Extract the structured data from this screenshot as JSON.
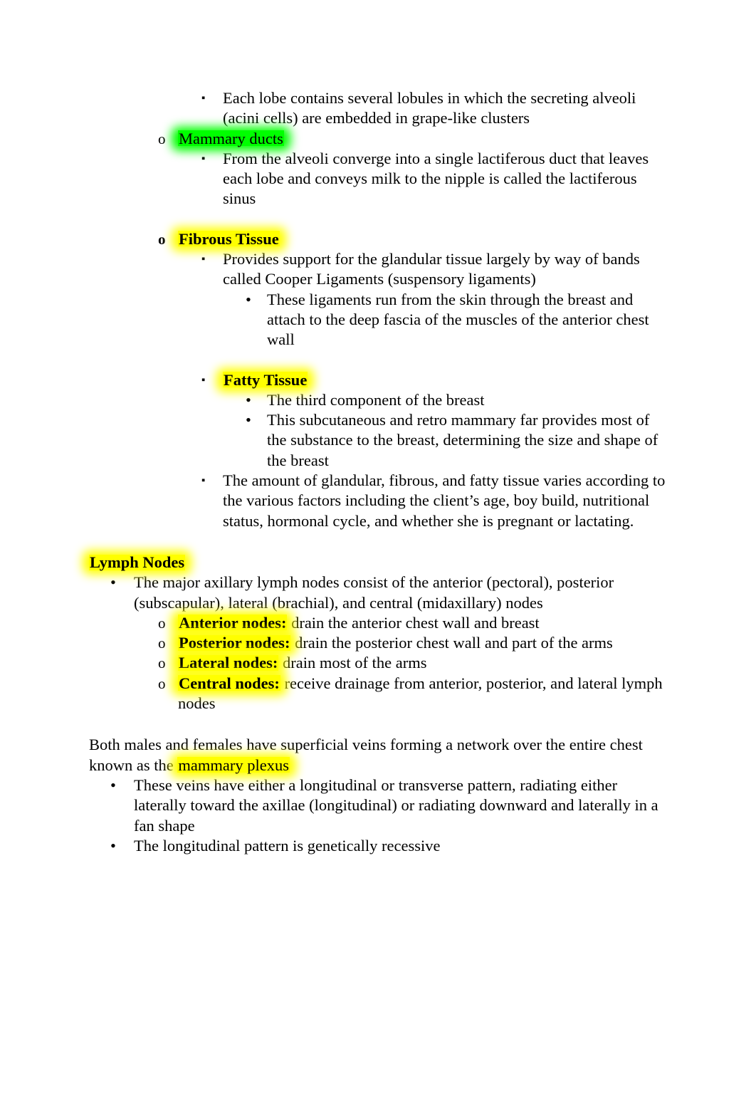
{
  "document": {
    "page_background": "#ffffff",
    "text_color": "#000000",
    "highlight_yellow": "#ffff00",
    "highlight_green": "#00ff00",
    "bullets": {
      "square": "▪",
      "disc": "•",
      "circle": "o"
    }
  },
  "blocks": [
    {
      "id": "b1",
      "level": "s1",
      "bullet": "square",
      "text": "Each lobe contains several lobules in which the secreting alveoli (acini cells) are embedded in grape-like clusters"
    },
    {
      "id": "b2",
      "level": "o1",
      "bullet": "circle",
      "text": "Mammary ducts",
      "highlight": "green",
      "bold": false
    },
    {
      "id": "b3",
      "level": "s1",
      "bullet": "square",
      "text": "From the alveoli converge into a single lactiferous duct that leaves each lobe and conveys milk to the nipple is called the lactiferous sinus"
    },
    {
      "id": "b4",
      "level": "o1",
      "bullet": "circle",
      "text": "Fibrous Tissue",
      "highlight": "yellow",
      "bold": true
    },
    {
      "id": "b5",
      "level": "s1",
      "bullet": "square",
      "text": "Provides support for the glandular tissue largely by way of bands called Cooper Ligaments (suspensory ligaments)"
    },
    {
      "id": "b6",
      "level": "d2",
      "bullet": "disc",
      "text": "These ligaments run from the skin through the breast and attach to the deep fascia of the muscles of the anterior chest wall"
    },
    {
      "id": "b7",
      "level": "s1",
      "bullet": "square",
      "text": "Fatty Tissue",
      "highlight": "yellow",
      "bold": true
    },
    {
      "id": "b8",
      "level": "d2",
      "bullet": "disc",
      "text": "The third component of the breast"
    },
    {
      "id": "b9",
      "level": "d2",
      "bullet": "disc",
      "text": "This subcutaneous and retro mammary far provides most of the substance to the breast, determining the size and shape of the breast"
    },
    {
      "id": "b10",
      "level": "s1",
      "bullet": "square",
      "text": "The amount of glandular, fibrous, and fatty tissue varies according to the various factors including the client’s age, boy build, nutritional status, hormonal cycle, and whether she is pregnant or lactating."
    }
  ],
  "lymph_section": {
    "heading": "Lymph Nodes",
    "heading_highlight": "yellow",
    "heading_bold": true,
    "intro": "The major axillary lymph nodes consist of the anterior (pectoral), posterior (subscapular), lateral (brachial), and central (midaxillary) nodes",
    "nodes": [
      {
        "label": "Anterior nodes:",
        "description": "drain the anterior chest wall and breast"
      },
      {
        "label": "Posterior nodes:",
        "description": "drain the posterior chest wall and part of the arms"
      },
      {
        "label": "Lateral nodes:",
        "description": "drain most of the arms"
      },
      {
        "label": "Central nodes:",
        "description": "receive drainage from anterior, posterior, and lateral lymph nodes"
      }
    ]
  },
  "veins_section": {
    "paragraph_part1": "Both males and females have superficial veins forming a network over the entire chest known as the ",
    "paragraph_highlight": "mammary plexus",
    "bullets": [
      "These veins have either a longitudinal or transverse pattern, radiating either laterally toward the axillae (longitudinal) or radiating downward and laterally in a fan shape",
      "The longitudinal pattern is genetically recessive"
    ]
  }
}
